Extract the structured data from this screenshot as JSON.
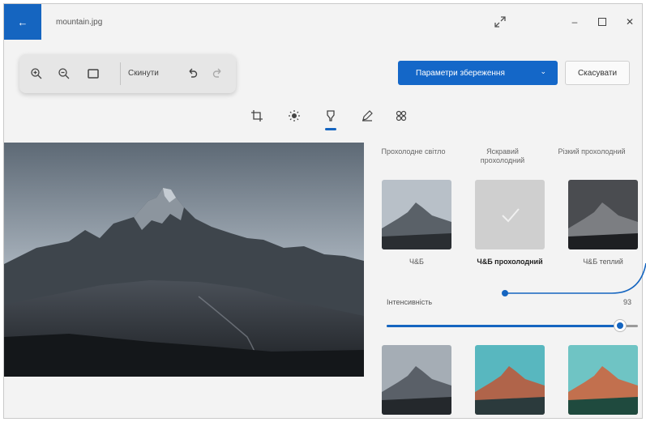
{
  "window": {
    "title": "mountain.jpg",
    "icons": [
      "arrow-left-icon",
      "expand-icon",
      "minimize-icon",
      "maximize-icon",
      "close-icon"
    ]
  },
  "toolbar": {
    "reset_label": "Скинути",
    "icons": [
      "zoom-in-icon",
      "zoom-out-icon",
      "fit-screen-icon",
      "undo-icon",
      "redo-icon"
    ]
  },
  "actions": {
    "save_label": "Параметри збереження",
    "cancel_label": "Скасувати"
  },
  "tabs": [
    {
      "icon": "crop-icon",
      "active": false
    },
    {
      "icon": "adjust-brightness-icon",
      "active": false
    },
    {
      "icon": "filter-icon",
      "active": true
    },
    {
      "icon": "markup-pen-icon",
      "active": false
    },
    {
      "icon": "effects-icon",
      "active": false
    }
  ],
  "filters": {
    "column_headers": [
      "Прохолодне світло",
      "Яскравий прохолодний",
      "Різкий прохолодний"
    ],
    "row1": [
      {
        "label": "Ч&Б",
        "selected": false
      },
      {
        "label": "Ч&Б прохолодний",
        "selected": true
      },
      {
        "label": "Ч&Б теплий",
        "selected": false
      }
    ],
    "intensity_label": "Інтенсивність",
    "intensity_value": "93",
    "intensity_fraction": 0.93
  },
  "colors": {
    "accent": "#1565c0",
    "background": "#f3f3f3"
  }
}
